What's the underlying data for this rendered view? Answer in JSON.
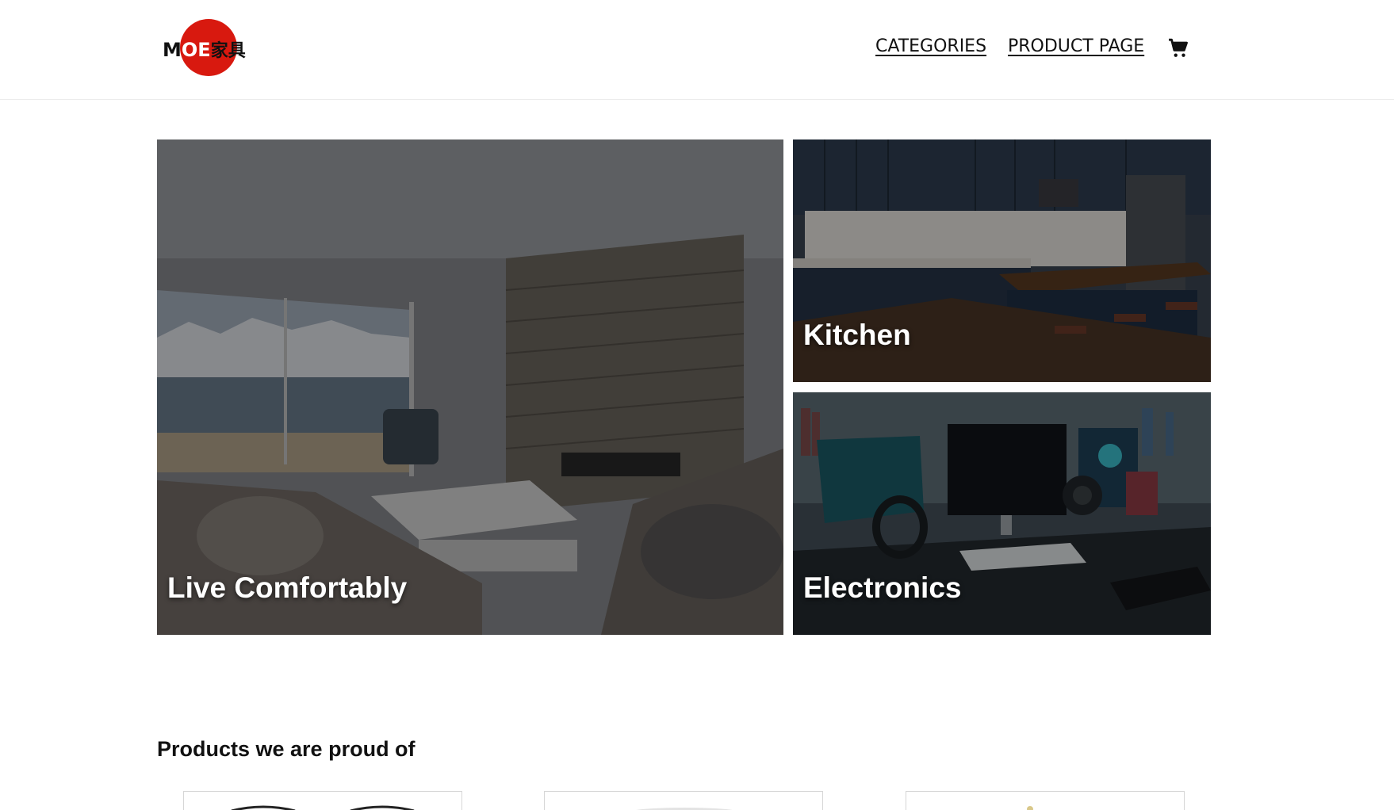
{
  "header": {
    "logo": {
      "prefix": "M",
      "middle": "OE",
      "suffix": "家具",
      "circle_color": "#d8190f"
    },
    "nav": [
      {
        "label": "CATEGORIES"
      },
      {
        "label": "PRODUCT PAGE"
      }
    ],
    "cart_icon": "shopping-cart-icon"
  },
  "hero": {
    "tiles": [
      {
        "label": "Live Comfortably",
        "image": "living-room-scene"
      },
      {
        "label": "Kitchen",
        "image": "kitchen-scene"
      },
      {
        "label": "Electronics",
        "image": "electronics-desk-scene"
      }
    ]
  },
  "products_section": {
    "title": "Products we are proud of",
    "cards": [
      {
        "image": "glasses-product-image"
      },
      {
        "image": "plate-product-image"
      },
      {
        "image": "lamp-product-image"
      }
    ]
  }
}
